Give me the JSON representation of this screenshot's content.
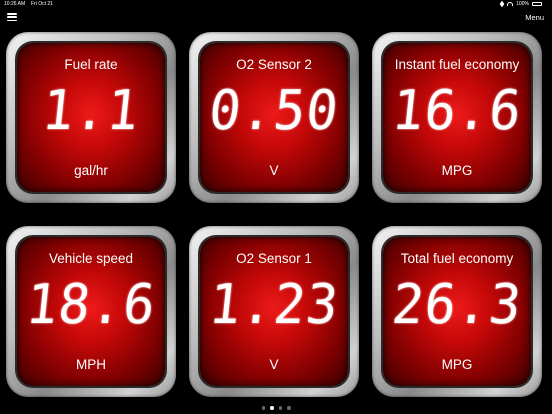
{
  "status": {
    "time": "10:26 AM",
    "date": "Fri Oct 21",
    "battery": "100%"
  },
  "header": {
    "menu_label": "Menu"
  },
  "gauges": [
    {
      "label": "Fuel rate",
      "value": "1.1",
      "unit": "gal/hr"
    },
    {
      "label": "O2 Sensor 2",
      "value": "0.50",
      "unit": "V"
    },
    {
      "label": "Instant fuel economy",
      "value": "16.6",
      "unit": "MPG"
    },
    {
      "label": "Vehicle speed",
      "value": "18.6",
      "unit": "MPH"
    },
    {
      "label": "O2 Sensor 1",
      "value": "1.23",
      "unit": "V"
    },
    {
      "label": "Total fuel economy",
      "value": "26.3",
      "unit": "MPG"
    }
  ],
  "pagination": {
    "count": 4,
    "current": 2
  },
  "colors": {
    "background": "#000000",
    "gauge_face": "#c40808",
    "bezel": "#bdbdbd"
  }
}
